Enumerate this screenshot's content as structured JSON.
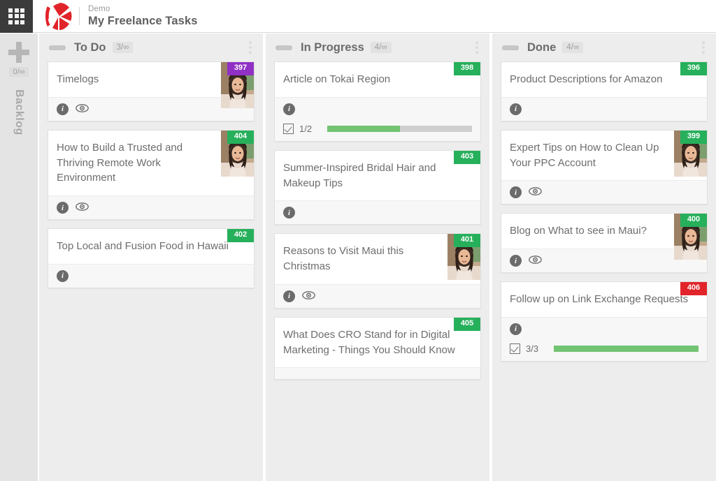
{
  "topbar": {
    "apps_icon": "apps-grid-icon",
    "logo_icon": "kanbanize-k-logo",
    "subtitle": "Demo",
    "title": "My Freelance Tasks"
  },
  "backlog_rail": {
    "plus_icon": "plus-icon",
    "count": "0/∞",
    "label": "Backlog"
  },
  "columns": [
    {
      "id": "todo",
      "title": "To Do",
      "count": "3/∞",
      "menu_icon": "kebab-menu-icon",
      "cards": [
        {
          "title": "Timelogs",
          "badge": "397",
          "badge_color": "#9030c4",
          "badge_style": "badge-purple",
          "avatar": true,
          "icons": [
            "info-icon",
            "eye-icon"
          ],
          "checklist": null
        },
        {
          "title": "How to Build a Trusted and Thriving Remote Work Environment",
          "badge": "404",
          "badge_color": "#26b05b",
          "badge_style": "badge-green",
          "avatar": true,
          "icons": [
            "info-icon",
            "eye-icon"
          ],
          "checklist": null
        },
        {
          "title": "Top Local and Fusion Food in Hawaii",
          "badge": "402",
          "badge_color": "#26b05b",
          "badge_style": "badge-green",
          "avatar": false,
          "icons": [
            "info-icon"
          ],
          "checklist": null
        }
      ]
    },
    {
      "id": "in-progress",
      "title": "In Progress",
      "count": "4/∞",
      "menu_icon": "kebab-menu-icon",
      "cards": [
        {
          "title": "Article on Tokai Region",
          "badge": "398",
          "badge_color": "#26b05b",
          "badge_style": "badge-green",
          "avatar": false,
          "icons": [
            "info-icon"
          ],
          "checklist": {
            "label": "1/2",
            "done": 1,
            "total": 2,
            "percent": 50
          }
        },
        {
          "title": "Summer-Inspired Bridal Hair and Makeup Tips",
          "badge": "403",
          "badge_color": "#26b05b",
          "badge_style": "badge-green",
          "avatar": false,
          "icons": [
            "info-icon"
          ],
          "checklist": null
        },
        {
          "title": "Reasons to Visit Maui this Christmas",
          "badge": "401",
          "badge_color": "#26b05b",
          "badge_style": "badge-green",
          "avatar": true,
          "icons": [
            "info-icon",
            "eye-icon"
          ],
          "checklist": null
        },
        {
          "title": "What Does CRO Stand for in Digital Marketing - Things You Should Know",
          "badge": "405",
          "badge_color": "#26b05b",
          "badge_style": "badge-green",
          "avatar": false,
          "icons": [],
          "checklist": null
        }
      ]
    },
    {
      "id": "done",
      "title": "Done",
      "count": "4/∞",
      "menu_icon": "kebab-menu-icon",
      "cards": [
        {
          "title": "Product Descriptions for Amazon",
          "badge": "396",
          "badge_color": "#26b05b",
          "badge_style": "badge-green",
          "avatar": false,
          "icons": [
            "info-icon"
          ],
          "checklist": null
        },
        {
          "title": "Expert Tips on How to Clean Up Your PPC Account",
          "badge": "399",
          "badge_color": "#26b05b",
          "badge_style": "badge-green",
          "avatar": true,
          "icons": [
            "info-icon",
            "eye-icon"
          ],
          "checklist": null
        },
        {
          "title": "Blog on What to see in Maui?",
          "badge": "400",
          "badge_color": "#26b05b",
          "badge_style": "badge-green",
          "avatar": true,
          "icons": [
            "info-icon",
            "eye-icon"
          ],
          "checklist": null
        },
        {
          "title": "Follow up on Link Exchange Requests",
          "badge": "406",
          "badge_color": "#e1242a",
          "badge_style": "badge-red",
          "avatar": false,
          "icons": [
            "info-icon"
          ],
          "checklist": {
            "label": "3/3",
            "done": 3,
            "total": 3,
            "percent": 100
          }
        }
      ]
    }
  ],
  "colors": {
    "green": "#26b05b",
    "purple": "#9030c4",
    "red": "#e1242a",
    "brand_red": "#e1242a",
    "column_bg": "#ededed",
    "progress_green": "#72c472"
  }
}
